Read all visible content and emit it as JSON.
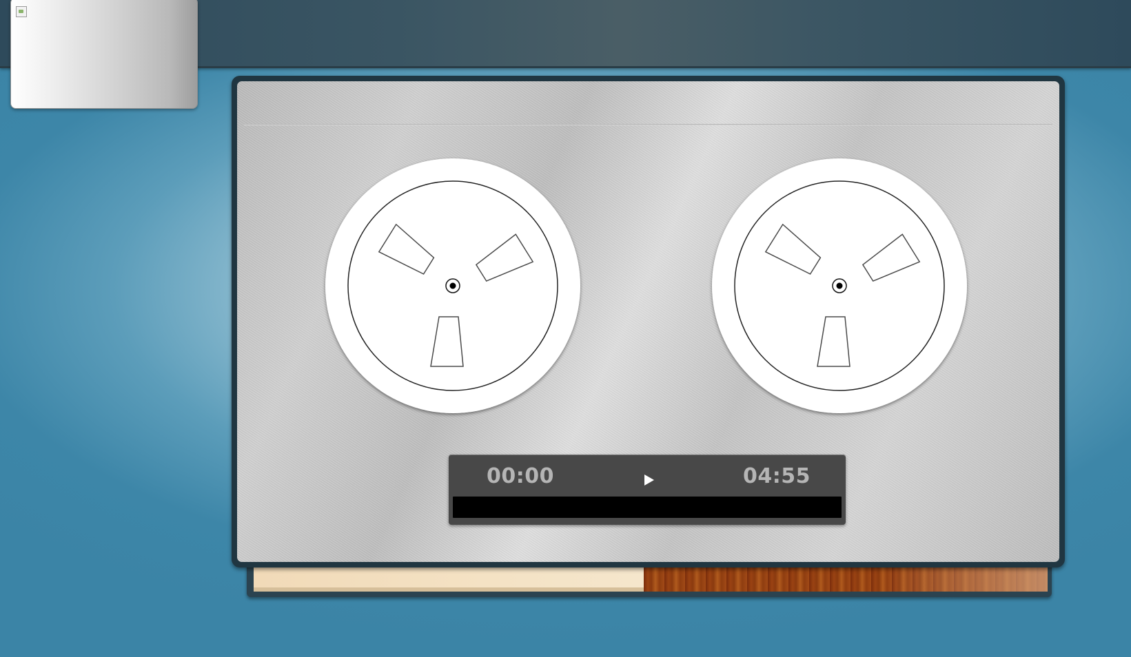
{
  "player": {
    "elapsed_time": "00:00",
    "total_time": "04:55",
    "play_icon": "play-icon",
    "progress_fraction": 0
  },
  "thumbnail": {
    "state": "broken-image",
    "icon": "broken-image-icon"
  },
  "reels": [
    {
      "name": "left-reel"
    },
    {
      "name": "right-reel"
    }
  ],
  "colors": {
    "background": "#3b84a6",
    "topbar": "#35505e",
    "control_panel": "#484848",
    "time_text": "#b5b5b5",
    "progress_track": "#000000"
  }
}
